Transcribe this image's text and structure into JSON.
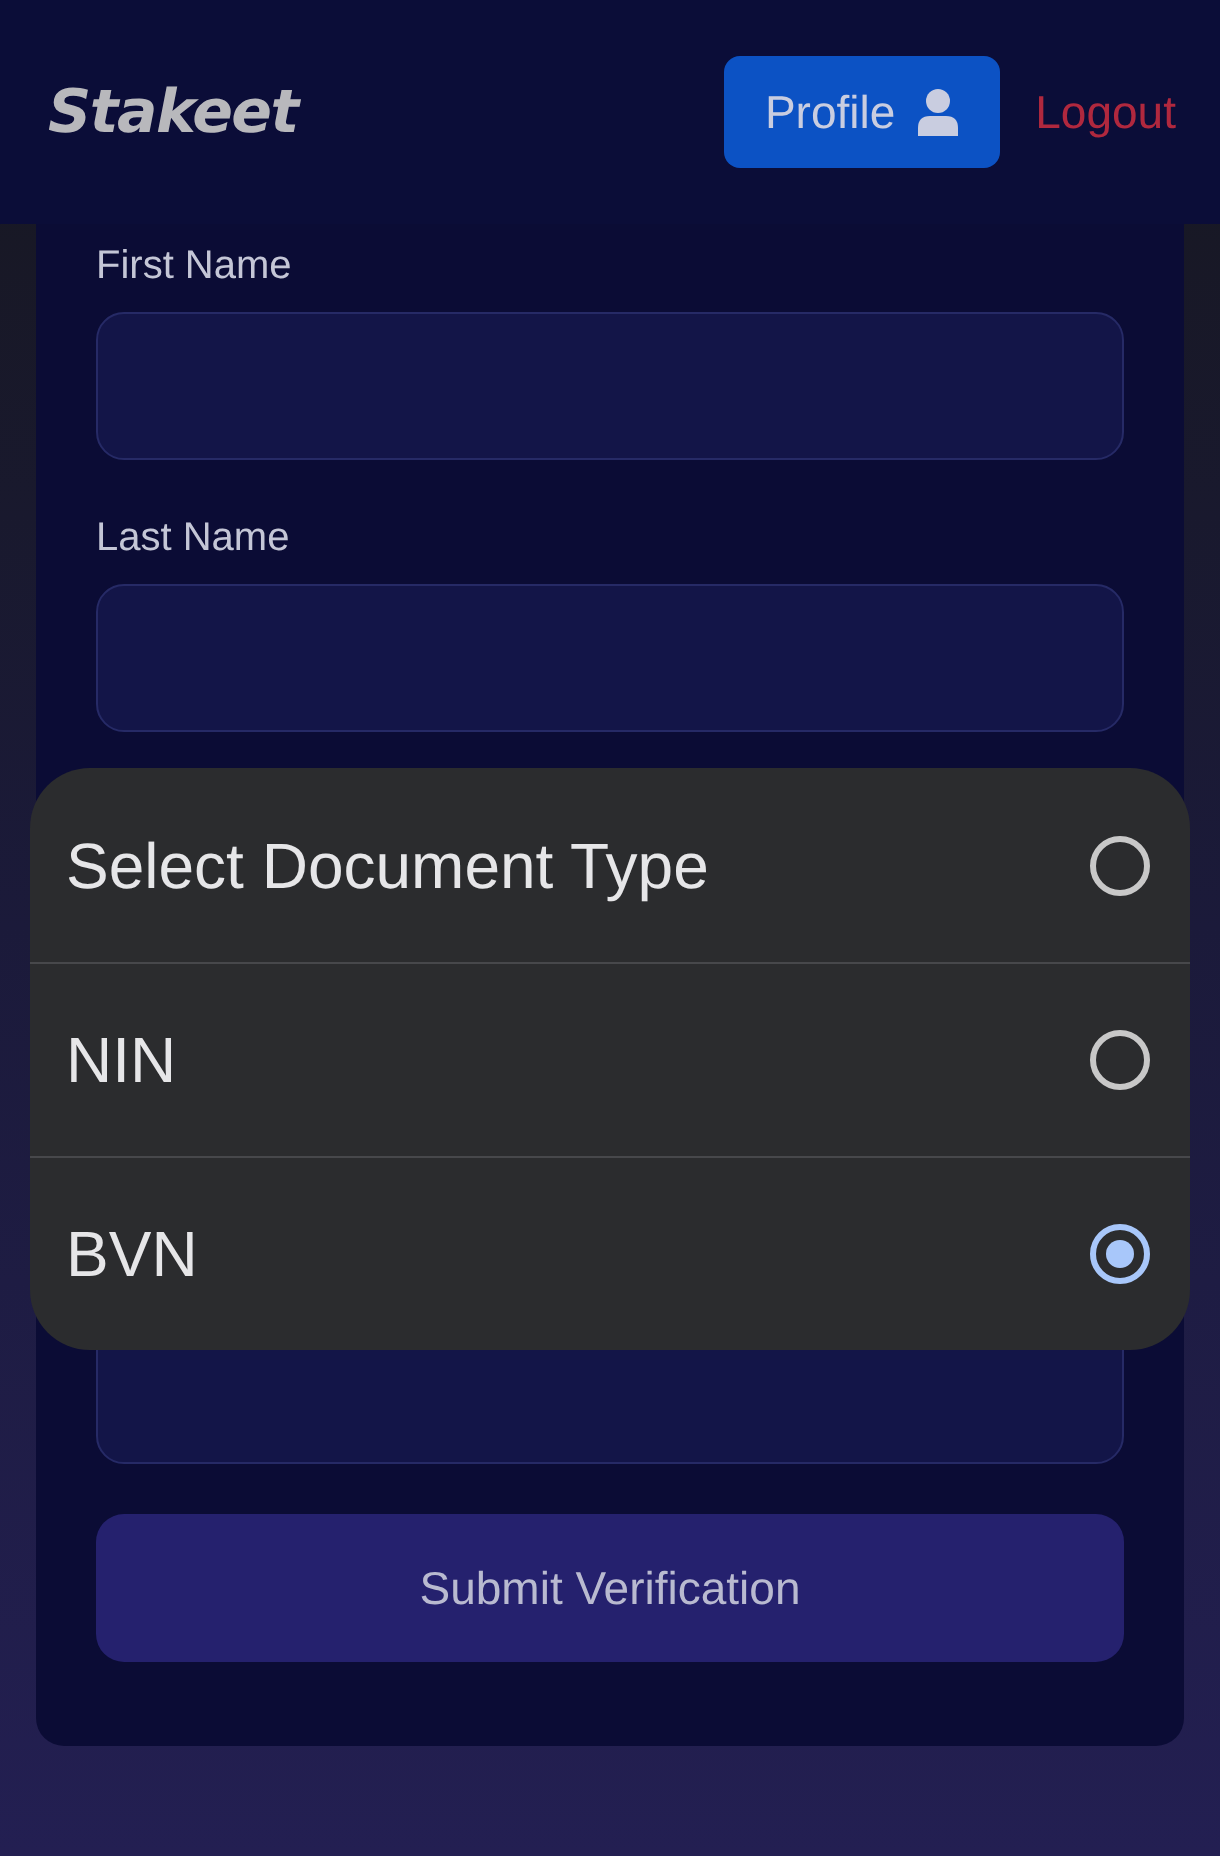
{
  "header": {
    "logo": "Stakeet",
    "profile_button": "Profile",
    "logout_link": "Logout"
  },
  "form": {
    "fields": [
      {
        "label": "First Name"
      },
      {
        "label": "Last Name"
      }
    ],
    "submit_button": "Submit Verification"
  },
  "document_picker": {
    "options": [
      {
        "label": "Select Document Type",
        "selected": false
      },
      {
        "label": "NIN",
        "selected": false
      },
      {
        "label": "BVN",
        "selected": true
      }
    ]
  }
}
